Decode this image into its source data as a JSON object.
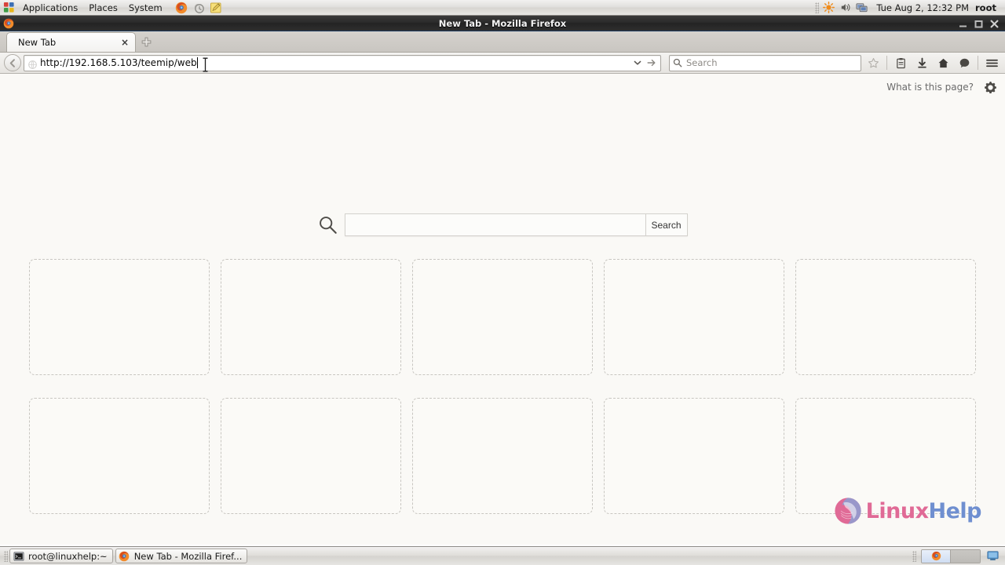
{
  "desktop": {
    "panel": {
      "menus": [
        {
          "label": "Applications",
          "name": "applications-menu"
        },
        {
          "label": "Places",
          "name": "places-menu"
        },
        {
          "label": "System",
          "name": "system-menu"
        }
      ],
      "launchers": [
        {
          "name": "firefox-launcher-icon",
          "title": "Firefox Web Browser"
        },
        {
          "name": "update-manager-icon",
          "title": "Update Manager"
        },
        {
          "name": "text-editor-icon",
          "title": "Text Editor"
        }
      ],
      "tray": [
        {
          "name": "brightness-icon"
        },
        {
          "name": "volume-icon"
        },
        {
          "name": "network-icon"
        }
      ],
      "clock": "Tue Aug  2, 12:32 PM",
      "user": "root"
    },
    "taskbar": {
      "windows": [
        {
          "label": "root@linuxhelp:~",
          "icon": "terminal-icon",
          "name": "taskbar-item-terminal"
        },
        {
          "label": "New Tab - Mozilla Firef...",
          "icon": "firefox-icon",
          "name": "taskbar-item-firefox"
        }
      ],
      "workspaces": [
        {
          "name": "workspace-1",
          "active": true
        },
        {
          "name": "workspace-2",
          "active": false
        }
      ],
      "show_desktop_label": "Show Desktop"
    }
  },
  "browser": {
    "window_title": "New Tab - Mozilla Firefox",
    "window_buttons": {
      "minimize": "Minimize",
      "maximize": "Maximize",
      "close": "Close"
    },
    "tabs": [
      {
        "label": "New Tab",
        "close_label": "×",
        "active": true
      }
    ],
    "new_tab_button_label": "+",
    "toolbar": {
      "back_label": "Back",
      "url_value": "http://192.168.5.103/teemip/web",
      "url_dropdown_label": "History dropdown",
      "go_label": "Go",
      "search_placeholder": "Search",
      "icons": [
        {
          "name": "bookmark-star-icon",
          "title": "Bookmark this page"
        },
        {
          "name": "reading-list-icon",
          "title": "Reading list"
        },
        {
          "name": "downloads-icon",
          "title": "Downloads"
        },
        {
          "name": "home-icon",
          "title": "Home"
        },
        {
          "name": "pocket-icon",
          "title": "Save to Pocket"
        },
        {
          "name": "menu-hamburger-icon",
          "title": "Open menu"
        }
      ]
    }
  },
  "newtab_page": {
    "what_is_this_page": "What is this page?",
    "settings_gear_label": "Settings",
    "search": {
      "value": "",
      "placeholder": "",
      "button_label": "Search"
    },
    "tiles": [
      {
        "name": "tile-1"
      },
      {
        "name": "tile-2"
      },
      {
        "name": "tile-3"
      },
      {
        "name": "tile-4"
      },
      {
        "name": "tile-5"
      },
      {
        "name": "tile-6"
      },
      {
        "name": "tile-7"
      },
      {
        "name": "tile-8"
      },
      {
        "name": "tile-9"
      },
      {
        "name": "tile-10"
      }
    ],
    "watermark": {
      "text_part1": "Linux",
      "text_part2": "Help",
      "color_part1": "#e06a96",
      "color_part2": "#6f8fd0"
    }
  },
  "colors": {
    "page_background": "#faf9f6",
    "tile_border": "#c8c6c1",
    "titlebar": "#2b2b2b",
    "panel": "#dfdedb"
  }
}
